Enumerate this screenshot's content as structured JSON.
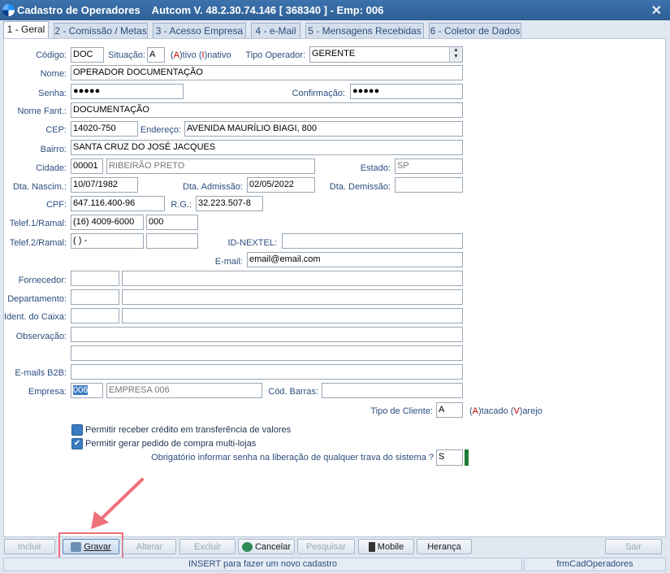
{
  "window": {
    "title": "Cadastro de Operadores    Autcom V. 48.2.30.74.146 [ 368340 ] - Emp: 006",
    "close_symbol": "✕"
  },
  "tabs": [
    {
      "label": "1 - Geral"
    },
    {
      "label": "2 - Comissão / Metas"
    },
    {
      "label": "3 - Acesso Empresa"
    },
    {
      "label": "4 - e-Mail"
    },
    {
      "label": "5 - Mensagens Recebidas"
    },
    {
      "label": "6 - Coletor de Dados"
    }
  ],
  "form": {
    "codigo": {
      "label": "Código:",
      "value": "DOC"
    },
    "situacao": {
      "label": "Situação:",
      "value": "A",
      "hint_prefix": "(",
      "hint_a": "A",
      "hint_mid": ")tivo (",
      "hint_i": "I",
      "hint_end": ")nativo"
    },
    "tipo_operador": {
      "label": "Tipo Operador:",
      "value": "GERENTE"
    },
    "nome": {
      "label": "Nome:",
      "value": "OPERADOR DOCUMENTAÇÃO"
    },
    "senha": {
      "label": "Senha:",
      "value": "●●●●●"
    },
    "confirmacao": {
      "label": "Confirmação:",
      "value": "●●●●●"
    },
    "nome_fant": {
      "label": "Nome Fant.:",
      "value": "DOCUMENTAÇÃO"
    },
    "cep": {
      "label": "CEP:",
      "value": "14020-750"
    },
    "endereco": {
      "label": "Endereço:",
      "value": "AVENIDA MAURÍLIO BIAGI, 800"
    },
    "bairro": {
      "label": "Bairro:",
      "value": "SANTA CRUZ DO JOSÉ JACQUES"
    },
    "cidade": {
      "label": "Cidade:",
      "code": "00001",
      "name": "RIBEIRÃO PRETO"
    },
    "estado": {
      "label": "Estado:",
      "value": "SP"
    },
    "dta_nascim": {
      "label": "Dta. Nascim.:",
      "value": "10/07/1982"
    },
    "dta_admissao": {
      "label": "Dta. Admissão:",
      "value": "02/05/2022"
    },
    "dta_demissao": {
      "label": "Dta. Demissão:",
      "value": ""
    },
    "cpf": {
      "label": "CPF:",
      "value": "647.116.400-96"
    },
    "rg": {
      "label": "R.G.:",
      "value": "32.223.507-8"
    },
    "telef1": {
      "label": "Telef.1/Ramal:",
      "value": "(16) 4009-6000",
      "ramal": "000"
    },
    "telef2": {
      "label": "Telef.2/Ramal:",
      "value": "(  )     -",
      "ramal": ""
    },
    "id_nextel": {
      "label": "ID-NEXTEL:",
      "value": ""
    },
    "email": {
      "label": "E-mail:",
      "value": "email@email.com"
    },
    "fornecedor": {
      "label": "Fornecedor:"
    },
    "departamento": {
      "label": "Departamento:"
    },
    "ident_caixa": {
      "label": "Ident. do Caixa:"
    },
    "observacao": {
      "label": "Observação:"
    },
    "emails_b2b": {
      "label": "E-mails B2B:"
    },
    "empresa": {
      "label": "Empresa:",
      "code": "006",
      "name": "EMPRESA 006"
    },
    "cod_barras": {
      "label": "Cód. Barras:",
      "value": ""
    },
    "tipo_cliente": {
      "label": "Tipo de Cliente:",
      "value": "A",
      "hint_prefix": "(",
      "hint_a": "A",
      "hint_mid": ")tacado (",
      "hint_v": "V",
      "hint_end": ")arejo"
    },
    "check_credito": {
      "label": "Permitir receber crédito em transferência de valores",
      "checked": false
    },
    "check_multilojas": {
      "label": "Permitir gerar pedido de compra multi-lojas",
      "checked": true,
      "mark": "✔"
    },
    "senha_trava": {
      "label": "Obrigatório informar senha na liberação de qualquer trava do sistema ?",
      "value": "S"
    }
  },
  "buttons": {
    "incluir": "Incluir",
    "gravar": "Gravar",
    "alterar": "Alterar",
    "excluir": "Excluir",
    "cancelar": "Cancelar",
    "pesquisar": "Pesquisar",
    "mobile": "Mobile",
    "heranca": "Herança",
    "sair": "Sair"
  },
  "status": {
    "hint": "INSERT para fazer um novo cadastro",
    "form_name": "frmCadOperadores"
  },
  "colors": {
    "highlight": "#f0707a",
    "accent": "#3f6fa6",
    "required": "#c00000",
    "green_marker": "#1e7b34"
  }
}
